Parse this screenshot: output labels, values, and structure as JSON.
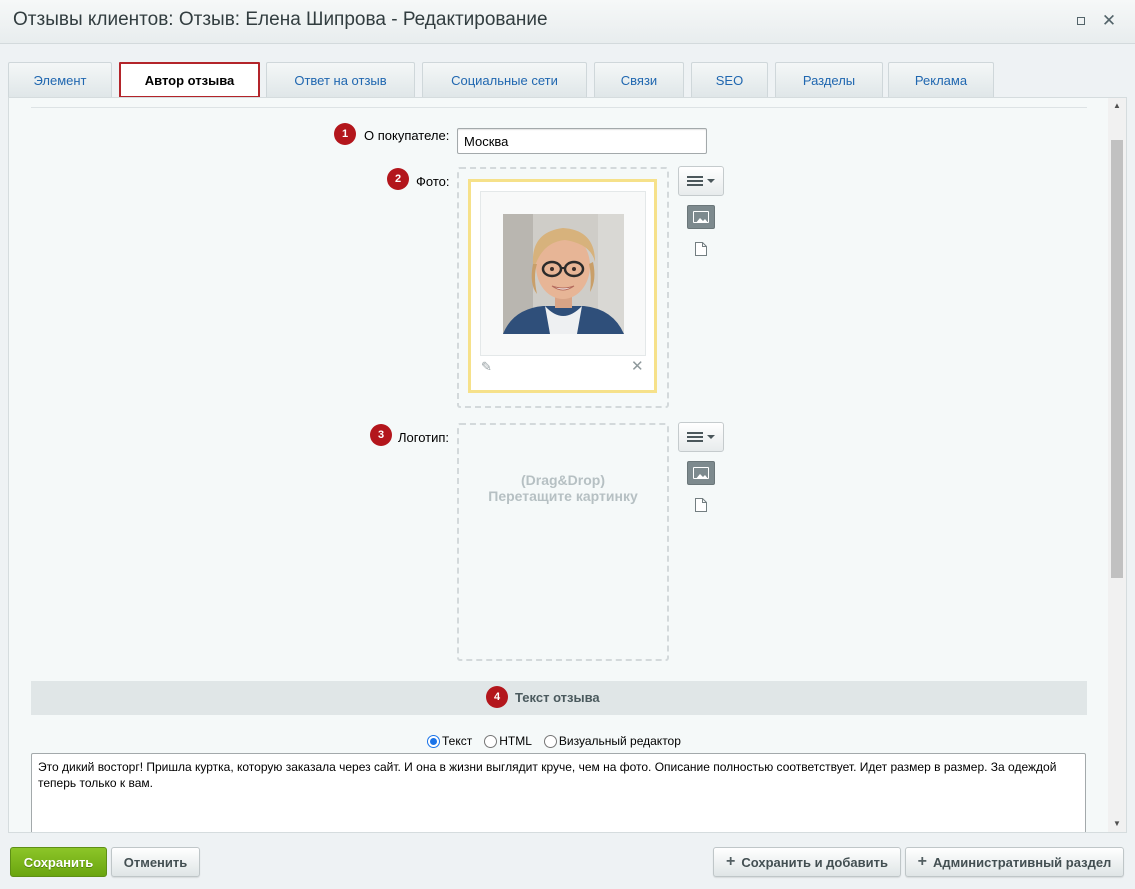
{
  "window": {
    "title": "Отзывы клиентов: Отзыв: Елена Шипрова - Редактирование",
    "maximize_icon": "maximize-icon",
    "close_icon": "close-icon"
  },
  "tabs": [
    {
      "label": "Элемент",
      "active": false
    },
    {
      "label": "Автор отзыва",
      "active": true
    },
    {
      "label": "Ответ на отзыв",
      "active": false
    },
    {
      "label": "Социальные сети",
      "active": false
    },
    {
      "label": "Связи",
      "active": false
    },
    {
      "label": "SEO",
      "active": false
    },
    {
      "label": "Разделы",
      "active": false
    },
    {
      "label": "Реклама",
      "active": false
    }
  ],
  "form": {
    "customer": {
      "badge": "1",
      "label": "О покупателе:",
      "value": "Москва"
    },
    "photo": {
      "badge": "2",
      "label": "Фото:"
    },
    "logo": {
      "badge": "3",
      "label": "Логотип:",
      "drop_line1": "(Drag&Drop)",
      "drop_line2": "Перетащите картинку"
    },
    "review_section": {
      "badge": "4",
      "title": "Текст отзыва"
    },
    "format_options": {
      "text": "Текст",
      "html": "HTML",
      "visual": "Визуальный редактор",
      "selected": "text"
    },
    "review_text": "Это дикий восторг! Пришла куртка, которую заказала через сайт. И она в жизни выглядит круче, чем на фото. Описание полностью соответствует. Идет размер в размер. За одеждой теперь только к вам."
  },
  "footer": {
    "save": "Сохранить",
    "cancel": "Отменить",
    "save_and_add": "Сохранить и добавить",
    "admin_section": "Административный раздел"
  },
  "colors": {
    "badge": "#b3161c",
    "active_tab_border": "#b3242a",
    "tab_text": "#2067b0",
    "save_button": "#7ab51c",
    "photo_frame": "#f6e18a"
  }
}
